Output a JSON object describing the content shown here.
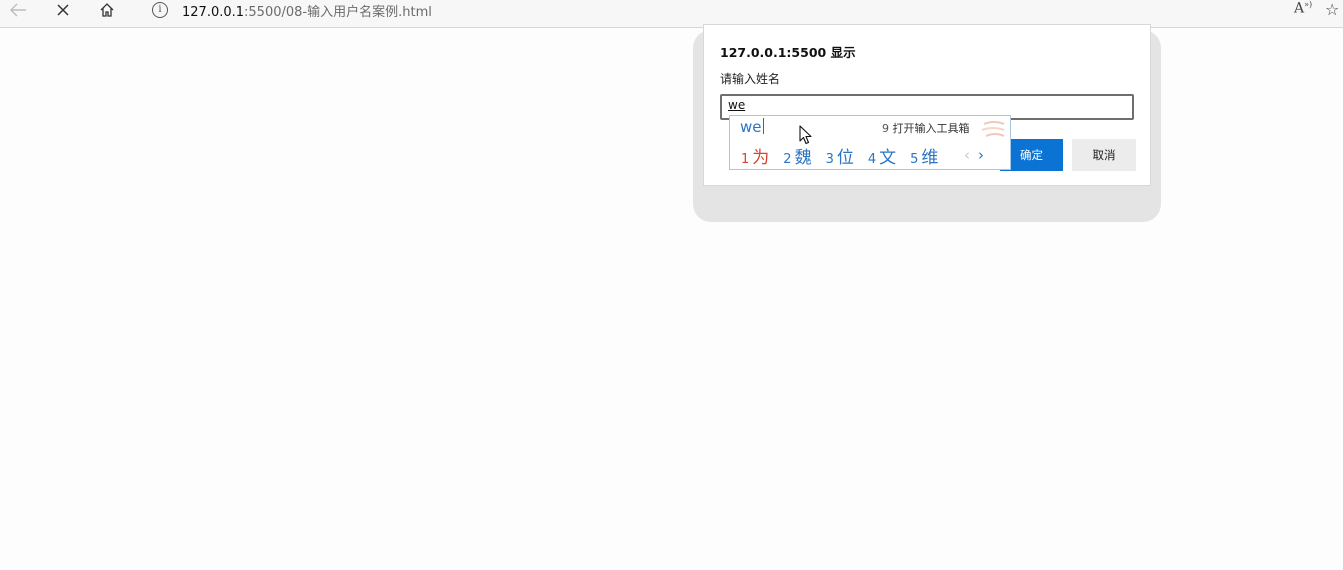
{
  "browser": {
    "url_host": "127.0.0.1",
    "url_path": ":5500/08-输入用户名案例.html",
    "info_glyph": "i",
    "read_aloud_glyph": "A",
    "read_aloud_sup": "»)",
    "icons": [
      "back-arrow-icon",
      "stop-icon",
      "home-icon",
      "info-icon",
      "read-aloud-icon",
      "favorites-star-icon"
    ]
  },
  "dialog": {
    "title": "127.0.0.1:5500 显示",
    "message": "请输入姓名",
    "input_value": "we",
    "ok_label": "确定",
    "cancel_label": "取消"
  },
  "ime": {
    "composition": "we",
    "tool_number": "9",
    "tool_label": "打开输入工具箱",
    "candidates": [
      {
        "num": "1",
        "text": "为"
      },
      {
        "num": "2",
        "text": "魏"
      },
      {
        "num": "3",
        "text": "位"
      },
      {
        "num": "4",
        "text": "文"
      },
      {
        "num": "5",
        "text": "维"
      }
    ],
    "prev_glyph": "‹",
    "next_glyph": "›"
  },
  "colors": {
    "accent": "#0a73d4",
    "ime_text": "#2b74c4",
    "ime_selected": "#d9432c"
  }
}
